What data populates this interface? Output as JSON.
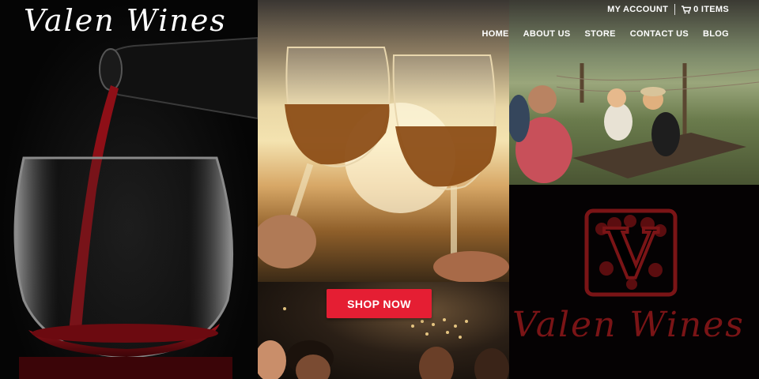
{
  "brand": {
    "name": "Valen Wines"
  },
  "utility": {
    "account_label": "MY ACCOUNT",
    "cart_label": "0 ITEMS",
    "cart_icon": "cart-icon"
  },
  "nav": {
    "items": [
      {
        "label": "HOME"
      },
      {
        "label": "ABOUT US"
      },
      {
        "label": "STORE"
      },
      {
        "label": "CONTACT US"
      },
      {
        "label": "BLOG"
      }
    ]
  },
  "hero": {
    "cta_label": "SHOP NOW"
  },
  "emblem": {
    "letter": "V",
    "script": "Valen Wines"
  },
  "colors": {
    "accent": "#e51e33",
    "wine": "#7a1416",
    "background": "#000000"
  }
}
